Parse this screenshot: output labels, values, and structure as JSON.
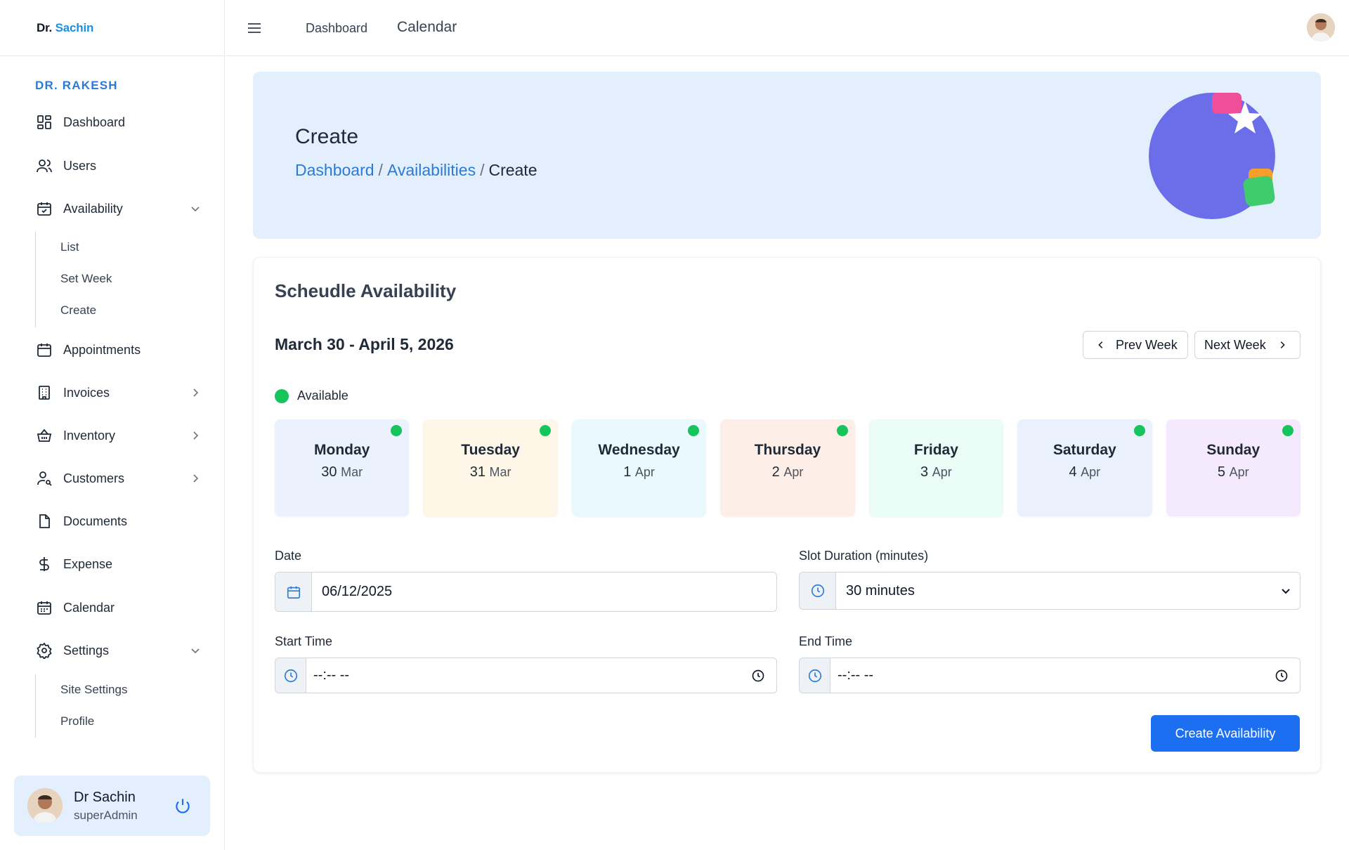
{
  "brand": {
    "prefix": "Dr.",
    "name": "Sachin"
  },
  "sidebar": {
    "role": "DR. RAKESH",
    "items": [
      {
        "label": "Dashboard",
        "icon": "dashboard-icon"
      },
      {
        "label": "Users",
        "icon": "users-icon"
      },
      {
        "label": "Availability",
        "icon": "calendar-check-icon",
        "expanded": true
      },
      {
        "label": "Appointments",
        "icon": "calendar-icon"
      },
      {
        "label": "Invoices",
        "icon": "building-icon"
      },
      {
        "label": "Inventory",
        "icon": "basket-icon"
      },
      {
        "label": "Customers",
        "icon": "user-search-icon"
      },
      {
        "label": "Documents",
        "icon": "document-icon"
      },
      {
        "label": "Expense",
        "icon": "dollar-icon"
      },
      {
        "label": "Calendar",
        "icon": "calendar-grid-icon"
      },
      {
        "label": "Settings",
        "icon": "gear-icon",
        "expanded": true
      }
    ],
    "availability_sub": [
      "List",
      "Set Week",
      "Create"
    ],
    "settings_sub": [
      "Site Settings",
      "Profile"
    ],
    "user": {
      "name": "Dr Sachin",
      "role": "superAdmin"
    }
  },
  "topbar": {
    "link1": "Dashboard",
    "link2": "Calendar"
  },
  "hero": {
    "title": "Create",
    "breadcrumb": [
      "Dashboard",
      "Availabilities",
      "Create"
    ],
    "separator": "/"
  },
  "card": {
    "title": "Scheudle Availability",
    "week_range": "March 30 - April 5, 2026",
    "prev_week": "Prev Week",
    "next_week": "Next Week",
    "legend_label": "Available"
  },
  "days": [
    {
      "name": "Monday",
      "day": "30",
      "month": "Mar",
      "available": true,
      "bg": "#ecf2fd"
    },
    {
      "name": "Tuesday",
      "day": "31",
      "month": "Mar",
      "available": true,
      "bg": "#fef6e7"
    },
    {
      "name": "Wednesday",
      "day": "1",
      "month": "Apr",
      "available": true,
      "bg": "#eaf9fe"
    },
    {
      "name": "Thursday",
      "day": "2",
      "month": "Apr",
      "available": true,
      "bg": "#fdeee7"
    },
    {
      "name": "Friday",
      "day": "3",
      "month": "Apr",
      "available": false,
      "bg": "#e9fdf6"
    },
    {
      "name": "Saturday",
      "day": "4",
      "month": "Apr",
      "available": true,
      "bg": "#eaf1fc"
    },
    {
      "name": "Sunday",
      "day": "5",
      "month": "Apr",
      "available": true,
      "bg": "#f5eafd"
    }
  ],
  "form": {
    "date_label": "Date",
    "date_value": "06/12/2025",
    "slot_label": "Slot Duration (minutes)",
    "slot_value": "30 minutes",
    "start_label": "Start Time",
    "start_value": "--:-- --",
    "end_label": "End Time",
    "end_value": "--:-- --",
    "submit": "Create Availability"
  },
  "colors": {
    "accent": "#1d6ff2",
    "available": "#16c45c",
    "hero_bg": "#e3effd"
  }
}
